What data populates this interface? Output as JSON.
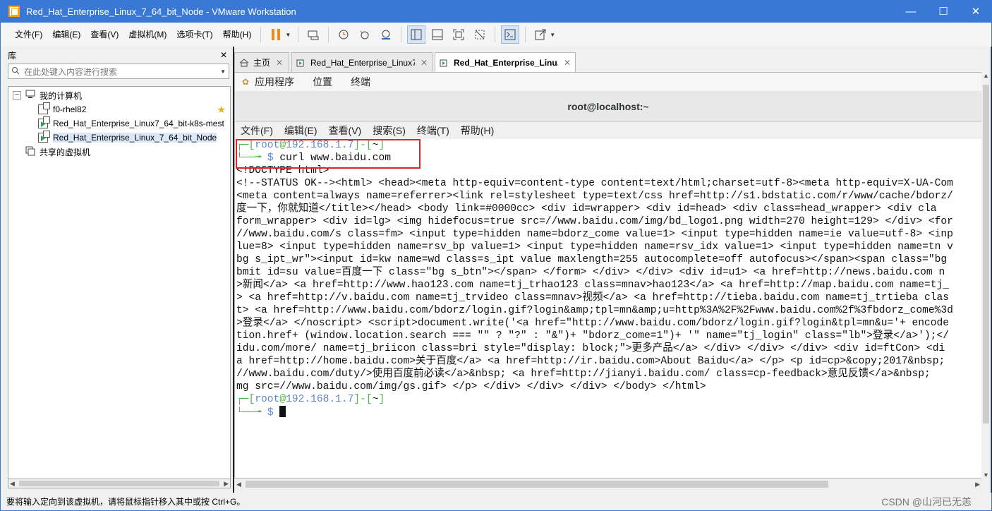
{
  "window": {
    "title": "Red_Hat_Enterprise_Linux_7_64_bit_Node - VMware Workstation",
    "minimize": "—",
    "maximize": "☐",
    "close": "✕"
  },
  "menu": [
    "文件(F)",
    "编辑(E)",
    "查看(V)",
    "虚拟机(M)",
    "选项卡(T)",
    "帮助(H)"
  ],
  "library": {
    "title": "库",
    "close": "✕",
    "search_placeholder": "在此处键入内容进行搜索",
    "tree": {
      "root": "我的计算机",
      "vms": [
        {
          "name": "f0-rhel82",
          "running": false,
          "starred": true
        },
        {
          "name": "Red_Hat_Enterprise_Linux7_64_bit-k8s-mest",
          "running": true,
          "starred": false
        },
        {
          "name": "Red_Hat_Enterprise_Linux_7_64_bit_Node",
          "running": true,
          "starred": false
        }
      ],
      "shared": "共享的虚拟机"
    }
  },
  "tabs": [
    {
      "label": "主页",
      "close": "✕"
    },
    {
      "label": "Red_Hat_Enterprise_Linux7_...",
      "close": "✕"
    },
    {
      "label": "Red_Hat_Enterprise_Linu...",
      "close": "✕"
    }
  ],
  "gnome": {
    "applications": "应用程序",
    "places": "位置",
    "terminal": "终端"
  },
  "terminal": {
    "title": "root@localhost:~",
    "menu": [
      "文件(F)",
      "编辑(E)",
      "查看(V)",
      "搜索(S)",
      "终端(T)",
      "帮助(H)"
    ],
    "prompt_user": "root",
    "prompt_at": "@",
    "prompt_host": "192.168.1.7",
    "prompt_dir": "~",
    "command": "curl www.baidu.com",
    "output": [
      "<!DOCTYPE html>",
      "<!--STATUS OK--><html> <head><meta http-equiv=content-type content=text/html;charset=utf-8><meta http-equiv=X-UA-Com",
      "<meta content=always name=referrer><link rel=stylesheet type=text/css href=http://s1.bdstatic.com/r/www/cache/bdorz/",
      "度一下，你就知道</title></head> <body link=#0000cc> <div id=wrapper> <div id=head> <div class=head_wrapper> <div cla",
      "form_wrapper> <div id=lg> <img hidefocus=true src=//www.baidu.com/img/bd_logo1.png width=270 height=129> </div> <for",
      "//www.baidu.com/s class=fm> <input type=hidden name=bdorz_come value=1> <input type=hidden name=ie value=utf-8> <inp",
      "lue=8> <input type=hidden name=rsv_bp value=1> <input type=hidden name=rsv_idx value=1> <input type=hidden name=tn v",
      "bg s_ipt_wr\"><input id=kw name=wd class=s_ipt value maxlength=255 autocomplete=off autofocus></span><span class=\"bg",
      "bmit id=su value=百度一下 class=\"bg s_btn\"></span> </form> </div> </div> <div id=u1> <a href=http://news.baidu.com n",
      ">新闻</a> <a href=http://www.hao123.com name=tj_trhao123 class=mnav>hao123</a> <a href=http://map.baidu.com name=tj_",
      "> <a href=http://v.baidu.com name=tj_trvideo class=mnav>视频</a> <a href=http://tieba.baidu.com name=tj_trtieba clas",
      "t> <a href=http://www.baidu.com/bdorz/login.gif?login&amp;tpl=mn&amp;u=http%3A%2F%2Fwww.baidu.com%2f%3fbdorz_come%3d",
      ">登录</a> </noscript> <script>document.write('<a href=\"http://www.baidu.com/bdorz/login.gif?login&tpl=mn&u='+ encode",
      "tion.href+ (window.location.search === \"\" ? \"?\" : \"&\")+ \"bdorz_come=1\")+ '\" name=\"tj_login\" class=\"lb\">登录</a>');</",
      "idu.com/more/ name=tj_briicon class=bri style=\"display: block;\">更多产品</a> </div> </div> </div> <div id=ftCon> <di",
      "a href=http://home.baidu.com>关于百度</a> <a href=http://ir.baidu.com>About Baidu</a> </p> <p id=cp>&copy;2017&nbsp;",
      "//www.baidu.com/duty/>使用百度前必读</a>&nbsp; <a href=http://jianyi.baidu.com/ class=cp-feedback>意见反馈</a>&nbsp;",
      "mg src=//www.baidu.com/img/gs.gif> </p> </div> </div> </div> </body> </html>"
    ]
  },
  "statusbar": {
    "text": "要将输入定向到该虚拟机，请将鼠标指针移入其中或按 Ctrl+G。",
    "watermark": "CSDN @山河已无恙"
  },
  "colors": {
    "titlebar": "#3a78d6",
    "prompt_green": "#4fb848",
    "prompt_blue": "#5e87c7",
    "highlight_box": "#e02323"
  }
}
